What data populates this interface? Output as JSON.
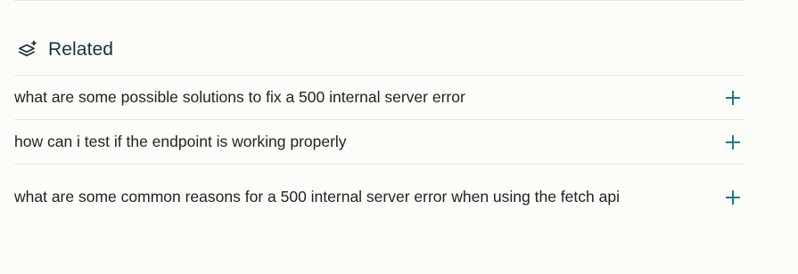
{
  "section": {
    "title": "Related",
    "icon": "stack-sparkle-icon",
    "accent_color": "#1f7a8c"
  },
  "related": [
    {
      "label": "what are some possible solutions to fix a 500 internal server error",
      "action_icon": "plus-icon"
    },
    {
      "label": "how can i test if the endpoint is working properly",
      "action_icon": "plus-icon"
    },
    {
      "label": "what are some common reasons for a 500 internal server error when using the fetch api",
      "action_icon": "plus-icon"
    }
  ]
}
